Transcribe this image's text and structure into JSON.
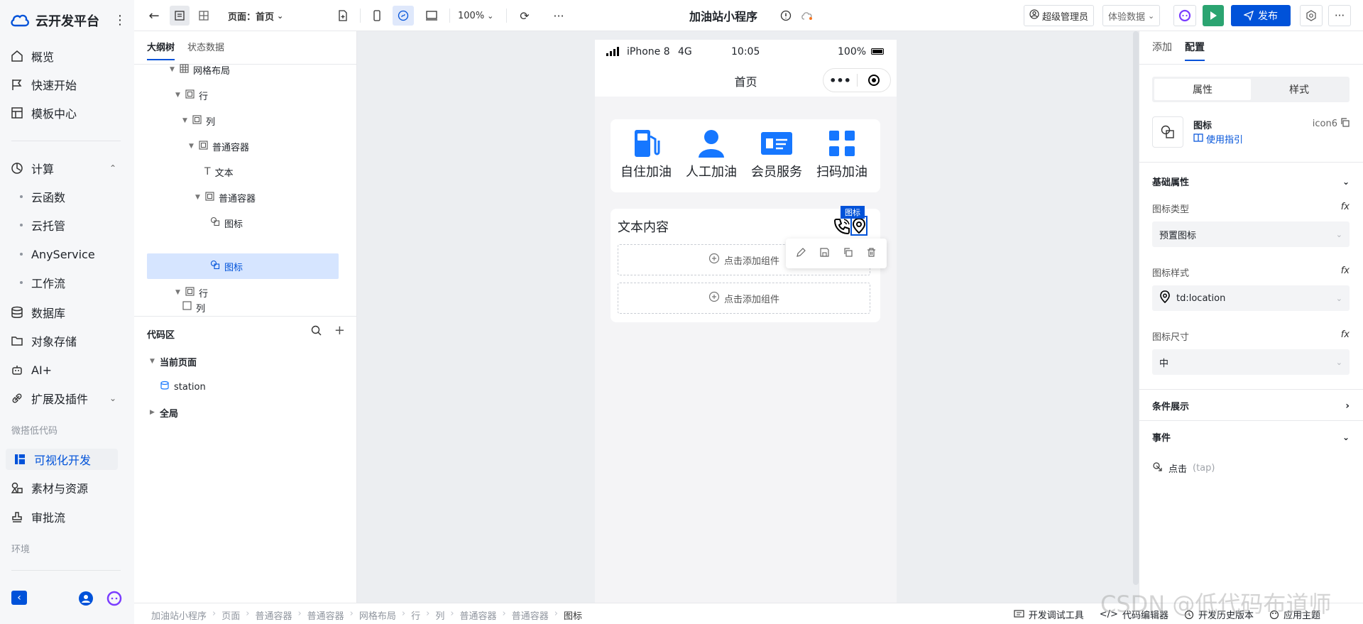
{
  "app": {
    "brand": "云开发平台",
    "nav": [
      {
        "label": "概览"
      },
      {
        "label": "快速开始"
      },
      {
        "label": "模板中心"
      },
      {
        "label": "计算"
      },
      {
        "label": "数据库"
      },
      {
        "label": "对象存储"
      },
      {
        "label": "AI+"
      },
      {
        "label": "扩展及插件"
      },
      {
        "label": "可视化开发"
      },
      {
        "label": "素材与资源"
      },
      {
        "label": "审批流"
      }
    ],
    "compute_sub": [
      "云函数",
      "云托管",
      "AnyService",
      "工作流"
    ],
    "section_lowcode": "微搭低代码",
    "section_env": "环境"
  },
  "toolbar": {
    "page_label": "页面：首页",
    "zoom": "100%",
    "project_title": "加油站小程序",
    "admin": "超级管理员",
    "data_mode": "体验数据",
    "publish": "发布"
  },
  "outline": {
    "tabs": [
      "大纲树",
      "状态数据"
    ],
    "nodes": [
      {
        "label": "网格布局"
      },
      {
        "label": "行"
      },
      {
        "label": "列"
      },
      {
        "label": "普通容器"
      },
      {
        "label": "文本"
      },
      {
        "label": "普通容器"
      },
      {
        "label": "图标"
      },
      {
        "label": "图标"
      },
      {
        "label": "行"
      },
      {
        "label": "列"
      }
    ],
    "code_area": "代码区",
    "code_tree": {
      "current_page": "当前页面",
      "item": "station",
      "global": "全局"
    }
  },
  "phone": {
    "device": "iPhone 8",
    "network": "4G",
    "time": "10:05",
    "battery": "100%",
    "page_title": "首页",
    "grid": [
      "自住加油",
      "人工加油",
      "会员服务",
      "扫码加油"
    ],
    "text_content": "文本内容",
    "selected_tag": "图标",
    "add_component": "点击添加组件",
    "colors": {
      "accent": "#1677ff"
    }
  },
  "config": {
    "tabs": [
      "添加",
      "配置"
    ],
    "segments": [
      "属性",
      "样式"
    ],
    "component_name": "图标",
    "component_id": "icon6",
    "guide": "使用指引",
    "basic_props": "基础属性",
    "icon_type_label": "图标类型",
    "icon_type_value": "预置图标",
    "icon_style_label": "图标样式",
    "icon_style_value": "td:location",
    "icon_size_label": "图标尺寸",
    "icon_size_value": "中",
    "condition": "条件展示",
    "events": "事件",
    "event_click": "点击",
    "event_tap": "(tap)"
  },
  "bottombar": {
    "breadcrumb": [
      "加油站小程序",
      "页面",
      "普通容器",
      "普通容器",
      "网格布局",
      "行",
      "列",
      "普通容器",
      "普通容器",
      "图标"
    ],
    "tools": [
      "开发调试工具",
      "代码编辑器",
      "开发历史版本",
      "应用主题"
    ]
  },
  "watermark": "CSDN @低代码布道师"
}
